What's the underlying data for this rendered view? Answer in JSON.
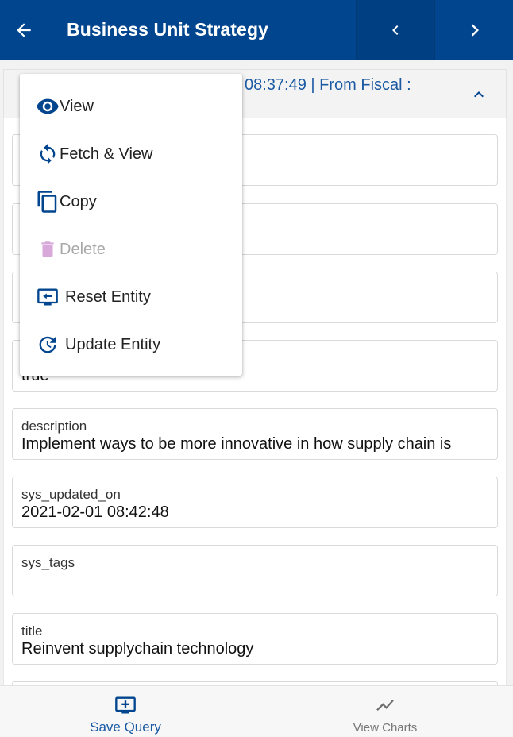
{
  "app": {
    "title": "Business Unit Strategy",
    "accent": "#00458e"
  },
  "header": {
    "text": "08:37:49 | From Fiscal :"
  },
  "fields": [
    {
      "label": "",
      "value": ""
    },
    {
      "label": "",
      "value": ""
    },
    {
      "label": "",
      "value": ""
    },
    {
      "label": "",
      "value": "true"
    },
    {
      "label": "description",
      "value": "Implement ways to be more innovative in how supply chain is"
    },
    {
      "label": "sys_updated_on",
      "value": "2021-02-01 08:42:48"
    },
    {
      "label": "sys_tags",
      "value": ""
    },
    {
      "label": "title",
      "value": "Reinvent supplychain technology"
    }
  ],
  "menu": {
    "items": [
      {
        "label": "View",
        "icon": "eye-icon",
        "enabled": true
      },
      {
        "label": "Fetch & View",
        "icon": "refresh-icon",
        "enabled": true
      },
      {
        "label": "Copy",
        "icon": "copy-icon",
        "enabled": true
      },
      {
        "label": "Delete",
        "icon": "trash-icon",
        "enabled": false
      },
      {
        "label": "Reset Entity",
        "icon": "reset-entity-icon",
        "enabled": true
      },
      {
        "label": "Update Entity",
        "icon": "update-entity-icon",
        "enabled": true
      }
    ]
  },
  "bottom": {
    "save_label": "Save Query",
    "charts_label": "View Charts"
  }
}
